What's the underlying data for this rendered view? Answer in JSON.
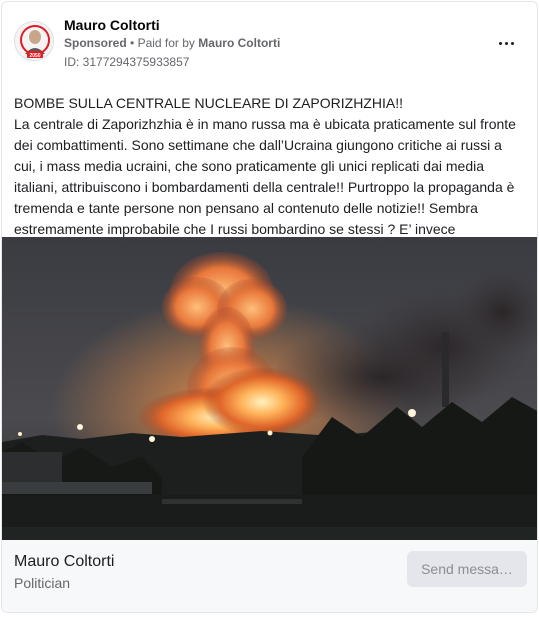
{
  "post": {
    "page_name": "Mauro Coltorti",
    "sponsored_label": "Sponsored",
    "separator": "•",
    "paid_for_prefix": "Paid for by",
    "paid_for_name": "Mauro Coltorti",
    "ad_id": "ID: 3177294375933857",
    "avatar_badge_text": "2050",
    "more_icon": "more-horizontal-icon"
  },
  "body": {
    "headline": "BOMBE SULLA CENTRALE NUCLEARE DI ZAPORIZHZHIA!!",
    "text": "La centrale di Zaporizhzhia è in mano russa ma è ubicata praticamente sul fronte dei combattimenti. Sono settimane che dall’Ucraina giungono critiche ai russi a cui, i mass media ucraini, che sono praticamente gli unici replicati dai media italiani, attribuiscono i bombardamenti della centrale!! Purtroppo la propaganda è tremenda e tante persone non pensano al contenuto delle notizie!! Sembra estremamente improbabile che I russi bombardino se stessi ? E’ invece evidente…"
  },
  "footer": {
    "name": "Mauro Coltorti",
    "category": "Politician",
    "cta_label": "Send messa…"
  },
  "colors": {
    "text_primary": "#1c1e21",
    "text_secondary": "#65676b",
    "footer_bg": "#f7f8fa",
    "cta_bg": "#e4e6eb",
    "badge_red": "#e31b23"
  }
}
